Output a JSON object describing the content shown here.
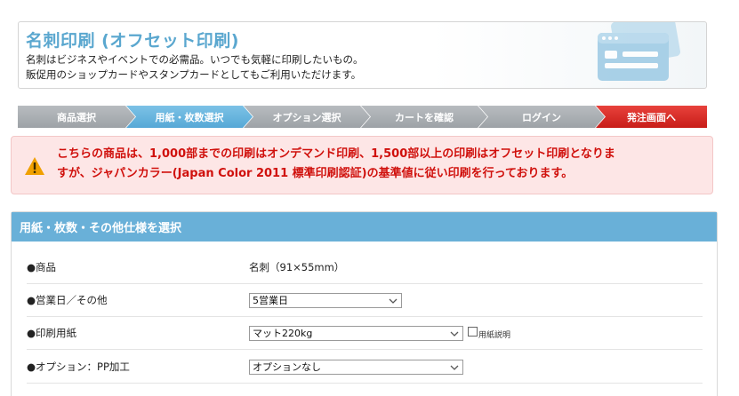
{
  "header": {
    "title": "名刺印刷 (オフセット印刷)",
    "desc_line1": "名刺はビジネスやイベントでの必需品。いつでも気軽に印刷したいもの。",
    "desc_line2": "販促用のショップカードやスタンプカードとしてもご利用いただけます。"
  },
  "steps": [
    {
      "label": "商品選択",
      "state": "done"
    },
    {
      "label": "用紙・枚数選択",
      "state": "current"
    },
    {
      "label": "オプション選択",
      "state": "todo"
    },
    {
      "label": "カートを確認",
      "state": "todo"
    },
    {
      "label": "ログイン",
      "state": "todo"
    },
    {
      "label": "発注画面へ",
      "state": "final"
    }
  ],
  "notice": {
    "icon": "warning-icon",
    "line1": "こちらの商品は、1,000部までの印刷はオンデマンド印刷、1,500部以上の印刷はオフセット印刷となりま",
    "line2": "すが、ジャパンカラー(Japan Color 2011 標準印刷認証)の基準値に従い印刷を行っております。"
  },
  "panel": {
    "title": "用紙・枚数・その他仕様を選択",
    "rows": [
      {
        "label": "●商品",
        "value": "名刺（91×55mm）"
      },
      {
        "label": "●営業日／その他",
        "select": "5営業日"
      },
      {
        "label": "●印刷用紙",
        "select": "マット220kg",
        "checkbox_label": "用紙説明"
      },
      {
        "label": "●オプション：PP加工",
        "select": "オプションなし"
      }
    ]
  },
  "colors": {
    "accent_blue": "#5aa7cf",
    "panel_header": "#69b0d8",
    "alert_red": "#d0100c",
    "alert_bg": "#fde6e6",
    "step_gray": "#a7acb1",
    "step_red": "#d42d27"
  }
}
